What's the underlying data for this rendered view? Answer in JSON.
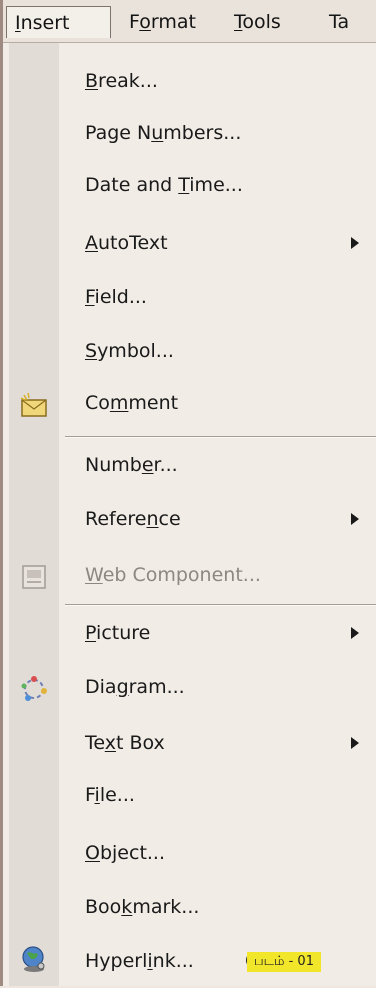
{
  "menubar": {
    "items": [
      {
        "pre": "",
        "u": "I",
        "post": "nsert"
      },
      {
        "pre": "F",
        "u": "o",
        "post": "rmat"
      },
      {
        "pre": "",
        "u": "T",
        "post": "ools"
      },
      {
        "pre": "Ta",
        "u": "",
        "post": ""
      }
    ]
  },
  "menu": {
    "items": [
      {
        "pre": "",
        "u": "B",
        "post": "reak..."
      },
      {
        "pre": "Page N",
        "u": "u",
        "post": "mbers..."
      },
      {
        "pre": "Date and ",
        "u": "T",
        "post": "ime..."
      },
      {
        "pre": "",
        "u": "A",
        "post": "utoText"
      },
      {
        "pre": "",
        "u": "F",
        "post": "ield..."
      },
      {
        "pre": "",
        "u": "S",
        "post": "ymbol..."
      },
      {
        "pre": "Co",
        "u": "m",
        "post": "ment"
      },
      {
        "pre": "Numb",
        "u": "e",
        "post": "r..."
      },
      {
        "pre": "Refere",
        "u": "n",
        "post": "ce"
      },
      {
        "pre": "",
        "u": "W",
        "post": "eb Component..."
      },
      {
        "pre": "",
        "u": "P",
        "post": "icture"
      },
      {
        "pre": "Dia",
        "u": "g",
        "post": "ram..."
      },
      {
        "pre": "Te",
        "u": "x",
        "post": "t Box"
      },
      {
        "pre": "F",
        "u": "i",
        "post": "le..."
      },
      {
        "pre": "",
        "u": "O",
        "post": "bject..."
      },
      {
        "pre": "Boo",
        "u": "k",
        "post": "mark..."
      },
      {
        "pre": "Hyperl",
        "u": "i",
        "post": "nk...",
        "shortcut": "Ctrl+K"
      }
    ]
  },
  "icons": {
    "comment": "comment-icon",
    "web_component": "web-component-icon",
    "diagram": "diagram-icon",
    "hyperlink": "hyperlink-globe-icon"
  },
  "caption": "படம் - 01",
  "colors": {
    "caption_bg": "#f2e62a",
    "disabled_text": "#8d8782"
  }
}
